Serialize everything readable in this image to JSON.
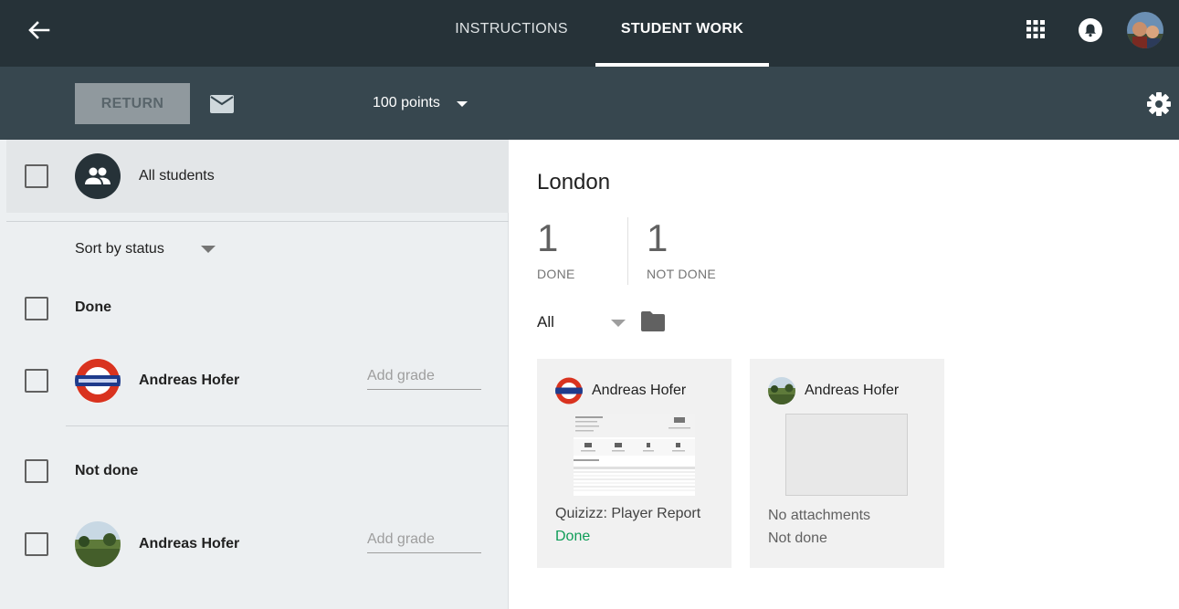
{
  "header": {
    "tabs": [
      {
        "label": "INSTRUCTIONS",
        "active": false
      },
      {
        "label": "STUDENT WORK",
        "active": true
      }
    ]
  },
  "toolbar": {
    "return_label": "RETURN",
    "points_label": "100 points"
  },
  "roster": {
    "all_students_label": "All students",
    "sort_label": "Sort by status",
    "groups": [
      {
        "label": "Done",
        "students": [
          {
            "name": "Andreas Hofer",
            "grade_placeholder": "Add grade"
          }
        ]
      },
      {
        "label": "Not done",
        "students": [
          {
            "name": "Andreas Hofer",
            "grade_placeholder": "Add grade"
          }
        ]
      }
    ]
  },
  "assignment": {
    "title": "London",
    "stats": [
      {
        "value": "1",
        "label": "DONE"
      },
      {
        "value": "1",
        "label": "NOT DONE"
      }
    ],
    "filter_label": "All",
    "cards": [
      {
        "name": "Andreas Hofer",
        "title": "Quizizz: Player Report",
        "status": "Done",
        "status_color": "#0f9d58"
      },
      {
        "name": "Andreas Hofer",
        "title": "No attachments",
        "status": "Not done",
        "status_color": "#616161"
      }
    ]
  },
  "colors": {
    "topbar": "#263238",
    "actionbar": "#37474f",
    "done_green": "#0f9d58"
  }
}
